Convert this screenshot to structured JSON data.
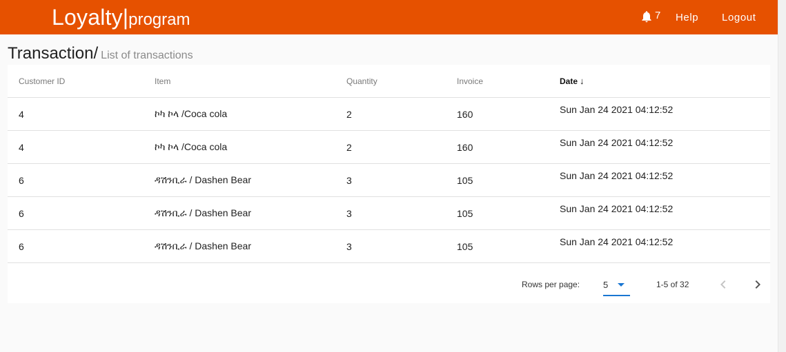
{
  "header": {
    "brand_main": "Loyalty",
    "brand_sep": "|",
    "brand_sub": "program",
    "notification_count": "7",
    "help_label": "Help",
    "logout_label": "Logout",
    "accent_color": "#e65100"
  },
  "page": {
    "title": "Transaction/",
    "subtitle": "List of transactions"
  },
  "table": {
    "columns": [
      "Customer ID",
      "Item",
      "Quantity",
      "Invoice",
      "Date"
    ],
    "sort_indicator": "↓",
    "rows": [
      {
        "customer_id": "4",
        "item": "ኮካ ኮላ /Coca cola",
        "quantity": "2",
        "invoice": "160",
        "date": "Sun Jan 24 2021 04:12:52"
      },
      {
        "customer_id": "4",
        "item": "ኮካ ኮላ /Coca cola",
        "quantity": "2",
        "invoice": "160",
        "date": "Sun Jan 24 2021 04:12:52"
      },
      {
        "customer_id": "6",
        "item": "ዳሽንቢራ / Dashen Bear",
        "quantity": "3",
        "invoice": "105",
        "date": "Sun Jan 24 2021 04:12:52"
      },
      {
        "customer_id": "6",
        "item": "ዳሽንቢራ / Dashen Bear",
        "quantity": "3",
        "invoice": "105",
        "date": "Sun Jan 24 2021 04:12:52"
      },
      {
        "customer_id": "6",
        "item": "ዳሽንቢራ / Dashen Bear",
        "quantity": "3",
        "invoice": "105",
        "date": "Sun Jan 24 2021 04:12:52"
      }
    ]
  },
  "pagination": {
    "rows_per_page_label": "Rows per page:",
    "rows_per_page_value": "5",
    "range_label": "1-5 of 32",
    "prev_icon": "chevron-left-icon",
    "next_icon": "chevron-right-icon"
  }
}
